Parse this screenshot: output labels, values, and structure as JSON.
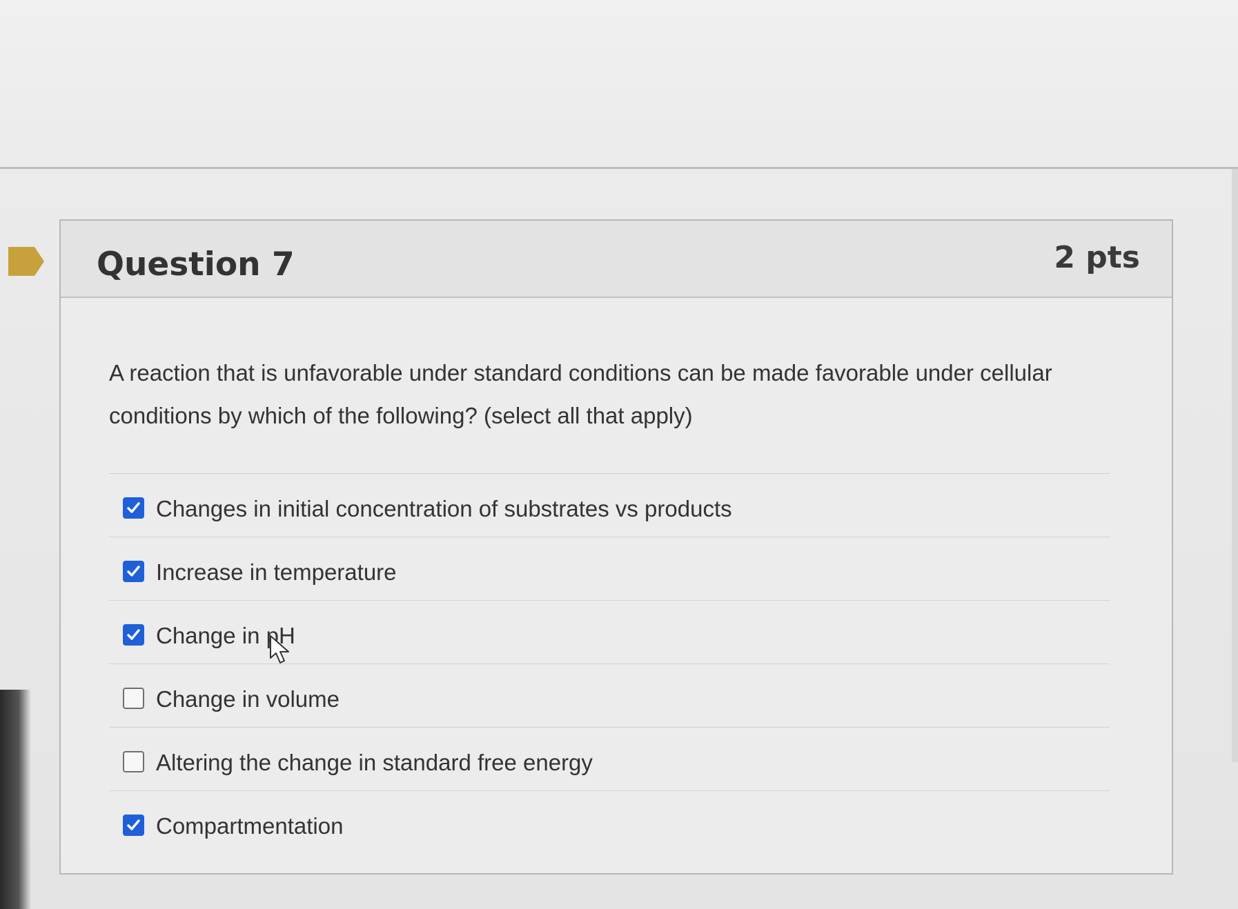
{
  "question": {
    "title": "Question 7",
    "points": "2 pts",
    "text_line_1": "A reaction that is unfavorable under standard conditions can be made favorable under cellular",
    "text_line_2": "conditions by which of the following? (select all that apply)"
  },
  "answers": [
    {
      "label": "Changes in initial concentration of substrates vs products",
      "checked": true
    },
    {
      "label": "Increase in temperature",
      "checked": true
    },
    {
      "label": "Change in pH",
      "checked": true
    },
    {
      "label": "Change in volume",
      "checked": false
    },
    {
      "label": "Altering the change in standard free energy",
      "checked": false
    },
    {
      "label": "Compartmentation",
      "checked": true
    }
  ],
  "colors": {
    "checkbox_checked": "#1f60d8",
    "bookmark": "#c7a13b",
    "text": "#333333"
  },
  "icons": {
    "bookmark": "bookmark-flag-icon",
    "checkmark": "checkmark-icon",
    "cursor": "mouse-cursor-icon"
  }
}
